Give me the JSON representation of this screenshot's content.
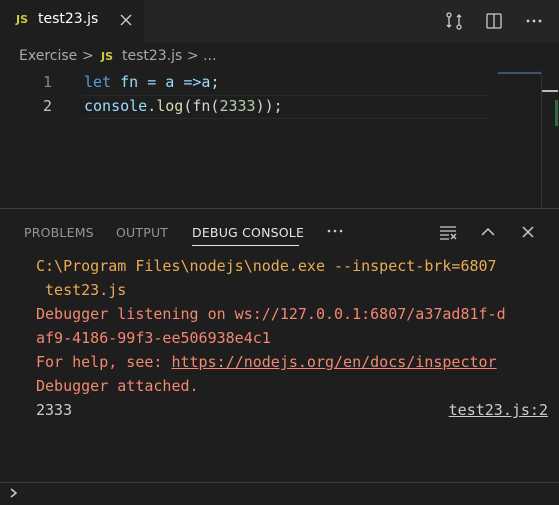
{
  "tab": {
    "badge": "JS",
    "filename": "test23.js"
  },
  "breadcrumb": {
    "folder": "Exercise",
    "sep": ">",
    "badge": "JS",
    "file": "test23.js",
    "tail": "> ..."
  },
  "editor": {
    "lines": [
      {
        "num": "1",
        "t1": "let",
        "t2": " fn = a =>",
        "t3": "a",
        "t4": ";"
      },
      {
        "num": "2",
        "t1": "console",
        "t2": ".",
        "t3": "log",
        "t4": "(fn(",
        "t5": "2333",
        "t6": "));"
      }
    ]
  },
  "panel": {
    "tabs": [
      "PROBLEMS",
      "OUTPUT",
      "DEBUG CONSOLE"
    ],
    "active_tab": "DEBUG CONSOLE",
    "more_label": "...",
    "console": {
      "l1": "C:\\Program Files\\nodejs\\node.exe --inspect-brk=6807",
      "l2": " test23.js",
      "l3": "Debugger listening on ws://127.0.0.1:6807/a37ad81f-d",
      "l4": "af9-4186-99f3-ee506938e4c1",
      "l5_prefix": "For help, see: ",
      "l5_link": "https://nodejs.org/en/docs/inspector",
      "l6": "Debugger attached.",
      "l7": "2333",
      "l7_source": "test23.js:2"
    }
  },
  "icons": {
    "tab_close": "close-icon",
    "compare": "compare-changes-icon",
    "split": "split-editor-icon",
    "more": "more-actions-icon",
    "clear": "clear-console-icon",
    "maximize": "chevron-up-icon",
    "panel_close": "close-icon",
    "prompt": "chevron-right-icon"
  },
  "colors": {
    "background": "#1e1e1e",
    "tabbar": "#252526",
    "js_badge": "#cbcb41",
    "keyword": "#569cd6",
    "warning": "#e9ab55",
    "error": "#f48771"
  }
}
